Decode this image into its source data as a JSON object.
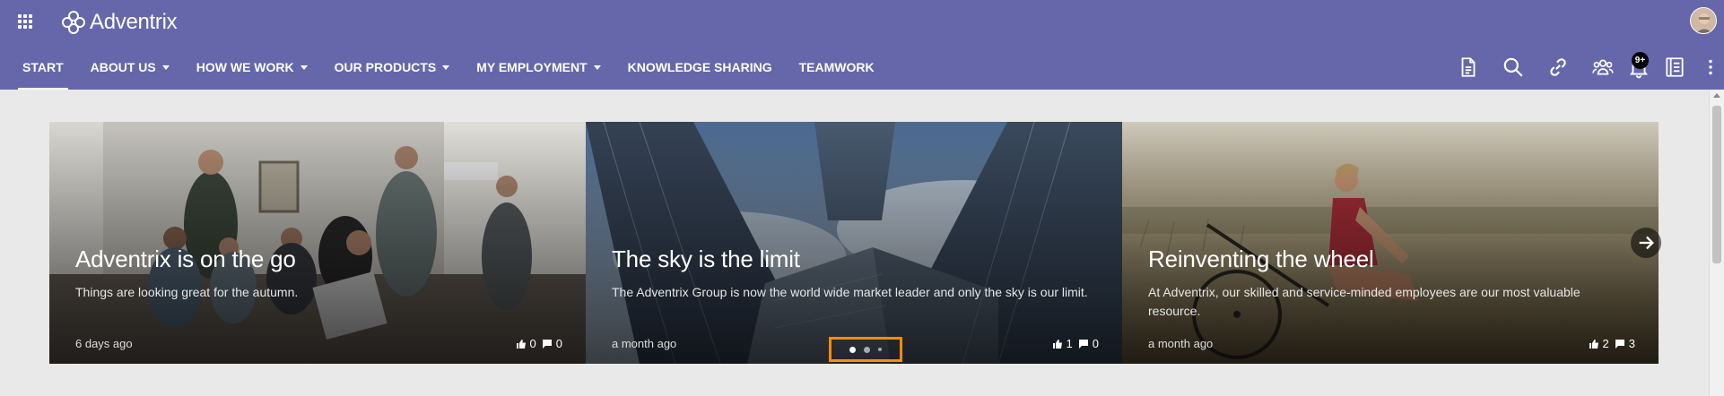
{
  "app": {
    "name": "Adventrix"
  },
  "nav": [
    {
      "label": "START",
      "active": true,
      "dropdown": false
    },
    {
      "label": "ABOUT US",
      "active": false,
      "dropdown": true
    },
    {
      "label": "HOW WE WORK",
      "active": false,
      "dropdown": true
    },
    {
      "label": "OUR PRODUCTS",
      "active": false,
      "dropdown": true
    },
    {
      "label": "MY EMPLOYMENT",
      "active": false,
      "dropdown": true
    },
    {
      "label": "KNOWLEDGE SHARING",
      "active": false,
      "dropdown": false
    },
    {
      "label": "TEAMWORK",
      "active": false,
      "dropdown": false
    }
  ],
  "toolbar": {
    "icons": [
      "document-icon",
      "search-icon",
      "link-icon",
      "people-icon",
      "bell-icon",
      "notebook-icon",
      "more-icon"
    ],
    "notification_badge": "9+"
  },
  "carousel": {
    "slides": [
      {
        "title": "Adventrix is on the go",
        "text": "Things are looking great for the autumn.",
        "date": "6 days ago",
        "likes": "0",
        "comments": "0"
      },
      {
        "title": "The sky is the limit",
        "text": "The Adventrix Group is now the world wide market leader and only the sky is our limit.",
        "date": "a month ago",
        "likes": "1",
        "comments": "0"
      },
      {
        "title": "Reinventing the wheel",
        "text": "At Adventrix, our skilled and service-minded employees are our most valuable resource.",
        "date": "a month ago",
        "likes": "2",
        "comments": "3"
      }
    ],
    "pagination": {
      "count": 3,
      "active_index": 0
    }
  },
  "colors": {
    "header": "#6667ab",
    "page_background": "#e9e9e9",
    "highlight": "#ff8c00"
  }
}
